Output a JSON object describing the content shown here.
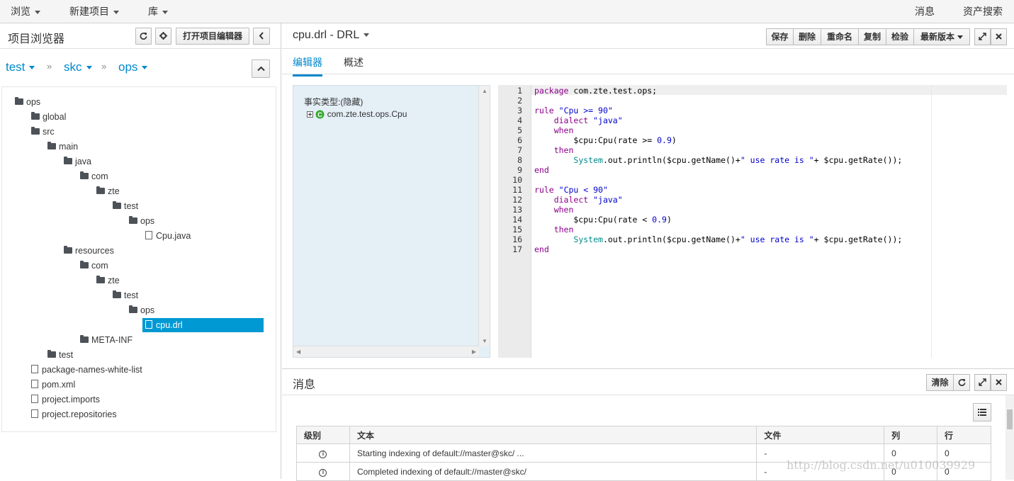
{
  "topnav": {
    "browse": "浏览",
    "new_item": "新建项目",
    "library": "库",
    "messages": "消息",
    "asset_search": "资产搜索"
  },
  "project_explorer": {
    "title": "项目浏览器",
    "open_editor": "打开项目编辑器",
    "breadcrumbs": [
      "test",
      "skc",
      "ops"
    ],
    "tree": [
      {
        "label": "ops",
        "type": "folder",
        "level": 0
      },
      {
        "label": "global",
        "type": "folder",
        "level": 1
      },
      {
        "label": "src",
        "type": "folder",
        "level": 1
      },
      {
        "label": "main",
        "type": "folder",
        "level": 2
      },
      {
        "label": "java",
        "type": "folder",
        "level": 3
      },
      {
        "label": "com",
        "type": "folder",
        "level": 4
      },
      {
        "label": "zte",
        "type": "folder",
        "level": 5
      },
      {
        "label": "test",
        "type": "folder",
        "level": 6
      },
      {
        "label": "ops",
        "type": "folder",
        "level": 7
      },
      {
        "label": "Cpu.java",
        "type": "file",
        "level": 8
      },
      {
        "label": "resources",
        "type": "folder",
        "level": 3
      },
      {
        "label": "com",
        "type": "folder",
        "level": 4
      },
      {
        "label": "zte",
        "type": "folder",
        "level": 5
      },
      {
        "label": "test",
        "type": "folder",
        "level": 6
      },
      {
        "label": "ops",
        "type": "folder",
        "level": 7
      },
      {
        "label": "cpu.drl",
        "type": "file",
        "level": 8,
        "selected": true
      },
      {
        "label": "META-INF",
        "type": "folder",
        "level": 4
      },
      {
        "label": "test",
        "type": "folder",
        "level": 2
      },
      {
        "label": "package-names-white-list",
        "type": "file",
        "level": 1
      },
      {
        "label": "pom.xml",
        "type": "file",
        "level": 1
      },
      {
        "label": "project.imports",
        "type": "file",
        "level": 1
      },
      {
        "label": "project.repositories",
        "type": "file",
        "level": 1
      }
    ]
  },
  "editor": {
    "title": "cpu.drl - DRL",
    "toolbar": {
      "save": "保存",
      "delete": "删除",
      "rename": "重命名",
      "copy": "复制",
      "validate": "检验",
      "latest_version": "最新版本"
    },
    "tabs": [
      "编辑器",
      "概述"
    ],
    "facts_label": "事实类型:(隐藏)",
    "fact_class": "com.zte.test.ops.Cpu",
    "code_lines": [
      "package com.zte.test.ops;",
      "",
      "rule \"Cpu >= 90\"",
      "    dialect \"java\"",
      "    when",
      "        $cpu:Cpu(rate >= 0.9)",
      "    then",
      "        System.out.println($cpu.getName()+\" use rate is \"+ $cpu.getRate());",
      "end",
      "",
      "rule \"Cpu < 90\"",
      "    dialect \"java\"",
      "    when",
      "        $cpu:Cpu(rate < 0.9)",
      "    then",
      "        System.out.println($cpu.getName()+\" use rate is \"+ $cpu.getRate());",
      "end"
    ]
  },
  "messages": {
    "title": "消息",
    "clear": "清除",
    "columns": [
      "级别",
      "文本",
      "文件",
      "列",
      "行"
    ],
    "rows": [
      {
        "text": "Starting indexing of default://master@skc/ ...",
        "file": "-",
        "col": "0",
        "line": "0"
      },
      {
        "text": "Completed indexing of default://master@skc/",
        "file": "-",
        "col": "0",
        "line": "0"
      }
    ]
  },
  "watermark": "http://blog.csdn.net/u010039929"
}
